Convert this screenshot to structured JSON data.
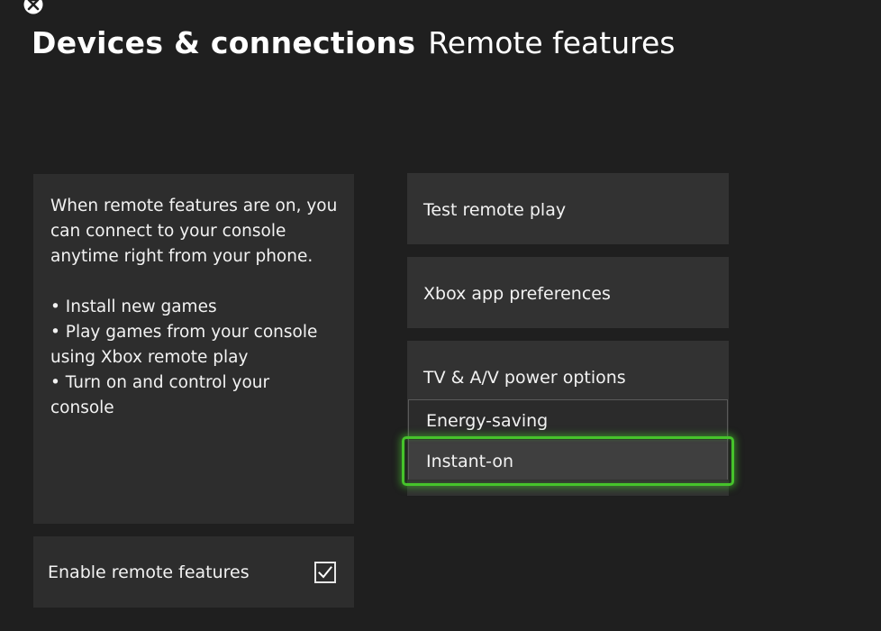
{
  "header": {
    "section": "Devices & connections",
    "page": "Remote features"
  },
  "info": {
    "description": "When remote features are on, you can connect to your console anytime right from your phone.",
    "bullets": [
      "• Install new games",
      "• Play games from your console using Xbox remote play",
      "• Turn on and control your console"
    ]
  },
  "enable_remote": {
    "label": "Enable remote features",
    "checked": true
  },
  "menu": {
    "test_remote_play": "Test remote play",
    "xbox_app_preferences": "Xbox app preferences",
    "tv_av_power_options": "TV & A/V power options"
  },
  "power_dropdown": {
    "options": [
      "Energy-saving",
      "Instant-on"
    ],
    "focused": "Instant-on"
  },
  "colors": {
    "background": "#1f1f1f",
    "tile": "#323232",
    "focus": "#46c32b"
  },
  "icons": {
    "logo": "xbox-logo-icon",
    "check": "checkmark-icon"
  }
}
